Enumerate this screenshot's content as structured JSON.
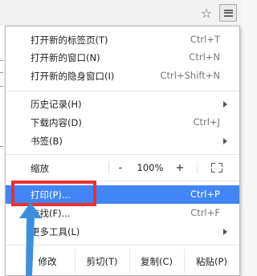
{
  "toolbar": {
    "star_icon": "☆",
    "menu_icon": "hamburger-menu-icon"
  },
  "menu": {
    "group1": [
      {
        "label": "打开新的标签页(T)",
        "shortcut": "Ctrl+T"
      },
      {
        "label": "打开新的窗口(N)",
        "shortcut": "Ctrl+N"
      },
      {
        "label": "打开新的隐身窗口(I)",
        "shortcut": "Ctrl+Shift+N"
      }
    ],
    "group2": [
      {
        "label": "历史记录(H)",
        "shortcut": ""
      },
      {
        "label": "下载内容(D)",
        "shortcut": "Ctrl+J"
      },
      {
        "label": "书签(B)",
        "shortcut": ""
      }
    ],
    "zoom": {
      "label": "缩放",
      "minus": "-",
      "value": "100%",
      "plus": "+"
    },
    "group3": [
      {
        "label": "打印(P)...",
        "shortcut": "Ctrl+P"
      },
      {
        "label": "查找(F)...",
        "shortcut": "Ctrl+F"
      },
      {
        "label": "更多工具(L)",
        "shortcut": ""
      }
    ],
    "edit": {
      "label": "修改",
      "cut": "剪切(T)",
      "copy": "复制(C)",
      "paste": "粘贴(P)"
    }
  },
  "colors": {
    "highlight": "#4285f4",
    "annotation_box": "#e8332f",
    "annotation_arrow": "#3d8fdc"
  }
}
